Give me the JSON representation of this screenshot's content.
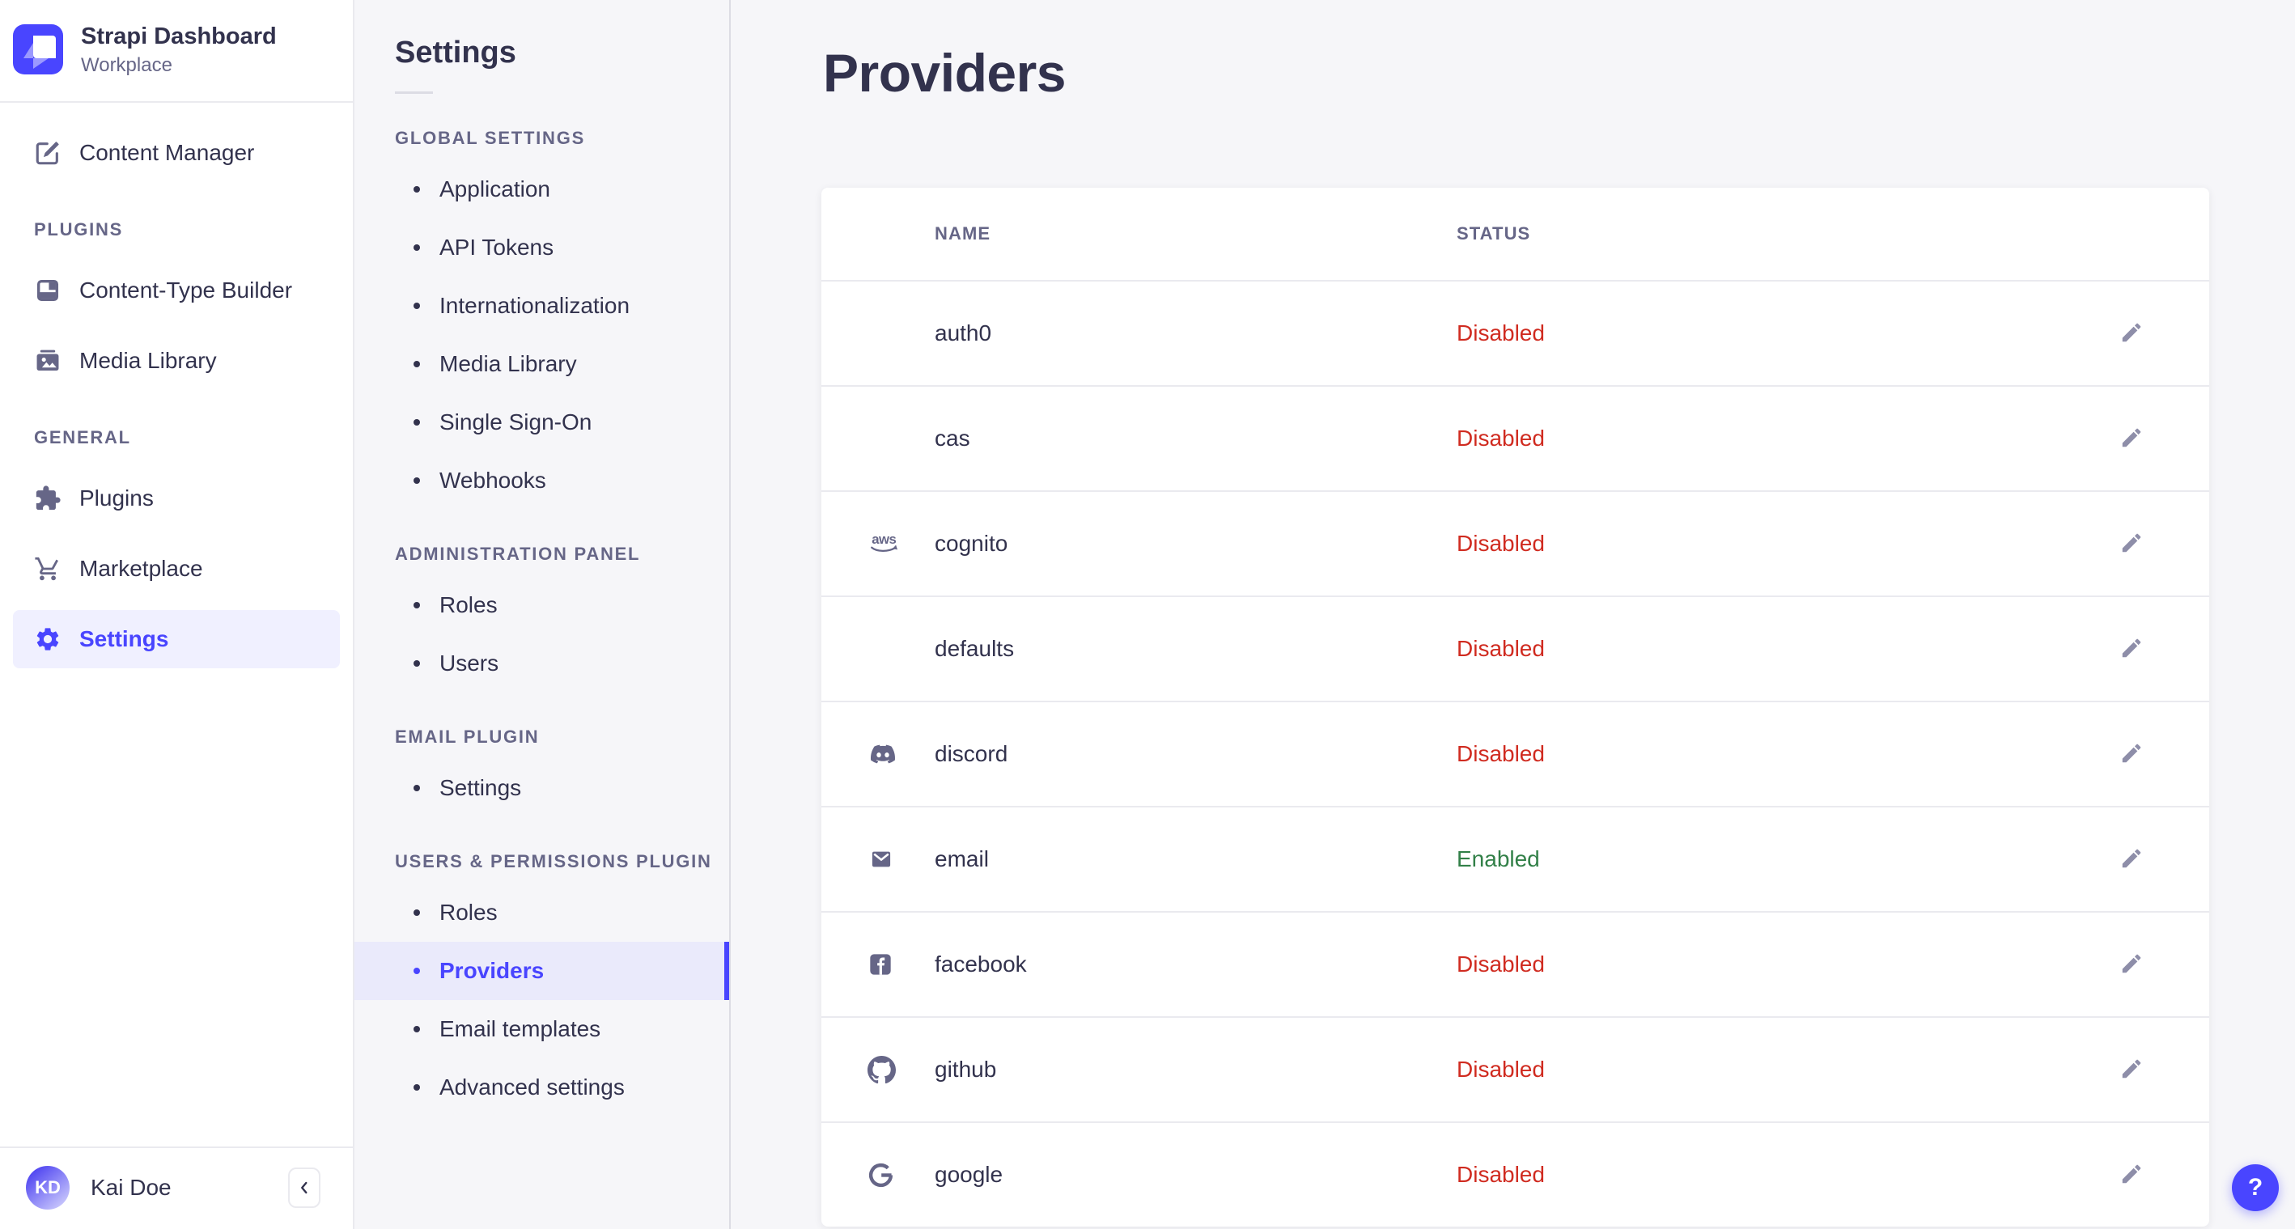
{
  "brand": {
    "title": "Strapi Dashboard",
    "subtitle": "Workplace"
  },
  "colors": {
    "primary": "#4945ff",
    "primary_bg": "#f0f0ff",
    "danger": "#d02b20",
    "success": "#328048"
  },
  "sidebar": {
    "items": [
      {
        "label": "Content Manager",
        "icon": "pen-square-icon",
        "active": false
      }
    ],
    "sections": [
      {
        "label": "PLUGINS",
        "items": [
          {
            "label": "Content-Type Builder",
            "icon": "layout-icon",
            "active": false
          },
          {
            "label": "Media Library",
            "icon": "image-icon",
            "active": false
          }
        ]
      },
      {
        "label": "GENERAL",
        "items": [
          {
            "label": "Plugins",
            "icon": "puzzle-icon",
            "active": false
          },
          {
            "label": "Marketplace",
            "icon": "cart-icon",
            "active": false
          },
          {
            "label": "Settings",
            "icon": "gear-icon",
            "active": true
          }
        ]
      }
    ],
    "user": {
      "initials": "KD",
      "name": "Kai Doe"
    },
    "collapse_icon": "chevron-left-icon"
  },
  "subnav": {
    "title": "Settings",
    "sections": [
      {
        "label": "GLOBAL SETTINGS",
        "items": [
          {
            "label": "Application",
            "active": false
          },
          {
            "label": "API Tokens",
            "active": false
          },
          {
            "label": "Internationalization",
            "active": false
          },
          {
            "label": "Media Library",
            "active": false
          },
          {
            "label": "Single Sign-On",
            "active": false
          },
          {
            "label": "Webhooks",
            "active": false
          }
        ]
      },
      {
        "label": "ADMINISTRATION PANEL",
        "items": [
          {
            "label": "Roles",
            "active": false
          },
          {
            "label": "Users",
            "active": false
          }
        ]
      },
      {
        "label": "EMAIL PLUGIN",
        "items": [
          {
            "label": "Settings",
            "active": false
          }
        ]
      },
      {
        "label": "USERS & PERMISSIONS PLUGIN",
        "items": [
          {
            "label": "Roles",
            "active": false
          },
          {
            "label": "Providers",
            "active": true
          },
          {
            "label": "Email templates",
            "active": false
          },
          {
            "label": "Advanced settings",
            "active": false
          }
        ]
      }
    ]
  },
  "main": {
    "title": "Providers",
    "table": {
      "columns": [
        "NAME",
        "STATUS"
      ],
      "rows": [
        {
          "name": "auth0",
          "status": "Disabled",
          "icon": null
        },
        {
          "name": "cas",
          "status": "Disabled",
          "icon": null
        },
        {
          "name": "cognito",
          "status": "Disabled",
          "icon": "aws-icon"
        },
        {
          "name": "defaults",
          "status": "Disabled",
          "icon": null
        },
        {
          "name": "discord",
          "status": "Disabled",
          "icon": "discord-icon"
        },
        {
          "name": "email",
          "status": "Enabled",
          "icon": "email-icon"
        },
        {
          "name": "facebook",
          "status": "Disabled",
          "icon": "facebook-icon"
        },
        {
          "name": "github",
          "status": "Disabled",
          "icon": "github-icon"
        },
        {
          "name": "google",
          "status": "Disabled",
          "icon": "google-icon"
        }
      ],
      "edit_icon": "pencil-icon"
    }
  },
  "help": {
    "label": "?"
  }
}
